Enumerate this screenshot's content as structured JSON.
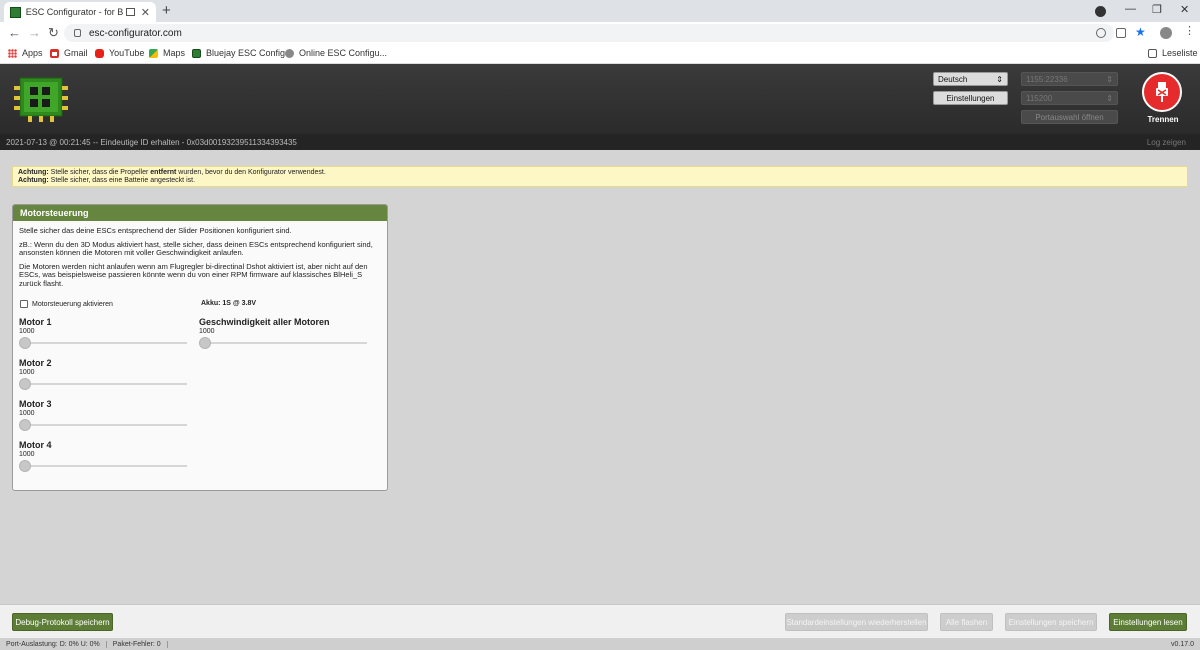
{
  "browser": {
    "tab_title": "ESC Configurator - for Blueja",
    "url": "esc-configurator.com",
    "bookmarks": [
      "Apps",
      "Gmail",
      "YouTube",
      "Maps",
      "Bluejay ESC Config...",
      "Online ESC Configu..."
    ],
    "reading_list": "Leseliste"
  },
  "header": {
    "language": "Deutsch",
    "settings_button": "Einstellungen",
    "port": "1155:22336",
    "baud": "115200",
    "port_select_button": "Portauswahl öffnen",
    "disconnect_label": "Trennen"
  },
  "logbar": {
    "message": "2021-07-13 @ 00:21:45 -- Eindeutige ID erhalten - 0x03d00193239511334393435",
    "show_log": "Log zeigen"
  },
  "warning": {
    "line1_label": "Achtung:",
    "line1_pre": " Stelle sicher, dass die Propeller ",
    "line1_bold": "entfernt",
    "line1_post": " wurden, bevor du den Konfigurator verwendest.",
    "line2_label": "Achtung:",
    "line2_text": " Stelle sicher, dass eine Batterie angesteckt ist."
  },
  "panel": {
    "title": "Motorsteuerung",
    "p1": "Stelle sicher das deine ESCs entsprechend der Slider Positionen konfiguriert sind.",
    "p2": "zB.: Wenn du den 3D Modus aktiviert hast, stelle sicher, dass deinen ESCs entsprechend konfiguriert sind, ansonsten können die Motoren mit voller Geschwindigkeit anlaufen.",
    "p3": "Die Motoren werden nicht anlaufen wenn am Flugregler bi-directinal Dshot aktiviert ist, aber nicht auf den ESCs, was beispielsweise passieren könnte wenn du von einer RPM firmware auf klassisches BlHeli_S zurück flasht.",
    "enable_label": "Motorsteuerung aktivieren",
    "akku": "Akku: 1S @ 3.8V",
    "motors": [
      {
        "name": "Motor 1",
        "value": "1000"
      },
      {
        "name": "Motor 2",
        "value": "1000"
      },
      {
        "name": "Motor 3",
        "value": "1000"
      },
      {
        "name": "Motor 4",
        "value": "1000"
      }
    ],
    "all_motors": {
      "name": "Geschwindigkeit aller Motoren",
      "value": "1000"
    }
  },
  "footer": {
    "debug_button": "Debug-Protokoll speichern",
    "restore_defaults": "Standardeinstellungen wiederherstellen",
    "flash_all": "Alle flashen",
    "save_settings": "Einstellungen speichern",
    "read_settings": "Einstellungen lesen"
  },
  "statusbar": {
    "port_usage": "Port-Auslastung: D: 0% U: 0%",
    "packet_errors": "Paket-Fehler: 0",
    "version": "v0.17.0"
  },
  "colors": {
    "panel_header": "#66853f",
    "button_green": "#5d7d37",
    "disconnect_red": "#e52b2b",
    "warning_bg": "#fdf6c5"
  }
}
